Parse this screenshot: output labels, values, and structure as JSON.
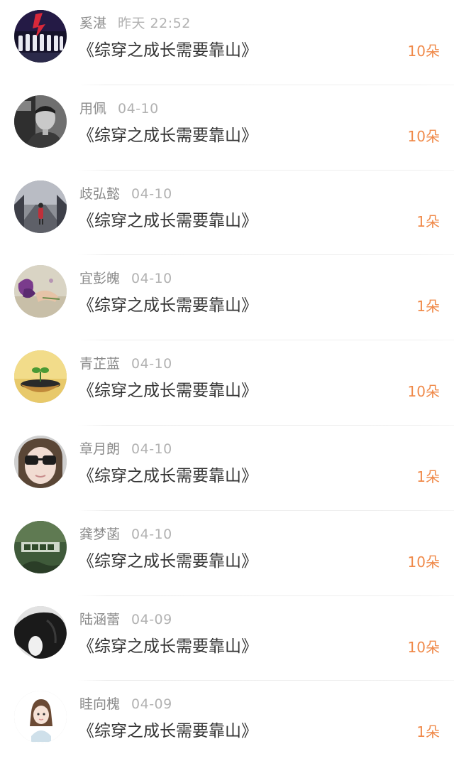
{
  "colors": {
    "amount": "#f08a4a",
    "name": "#8a8a8a",
    "time": "#b2b2b2",
    "title": "#333333"
  },
  "items": [
    {
      "name": "奚湛",
      "time": "昨天 22:52",
      "title": "《综穿之成长需要靠山》",
      "amount": "10朵",
      "avatar_icon": "stage-performers-avatar"
    },
    {
      "name": "用佩",
      "time": "04-10",
      "title": "《综穿之成长需要靠山》",
      "amount": "10朵",
      "avatar_icon": "man-portrait-avatar"
    },
    {
      "name": "歧弘懿",
      "time": "04-10",
      "title": "《综穿之成长需要靠山》",
      "amount": "1朵",
      "avatar_icon": "street-girl-avatar"
    },
    {
      "name": "宜彭魄",
      "time": "04-10",
      "title": "《综穿之成长需要靠山》",
      "amount": "1朵",
      "avatar_icon": "flowers-hand-avatar"
    },
    {
      "name": "青芷蓝",
      "time": "04-10",
      "title": "《综穿之成长需要靠山》",
      "amount": "10朵",
      "avatar_icon": "sprout-pot-avatar"
    },
    {
      "name": "章月朗",
      "time": "04-10",
      "title": "《综穿之成长需要靠山》",
      "amount": "1朵",
      "avatar_icon": "sunglasses-girl-avatar"
    },
    {
      "name": "龚梦菡",
      "time": "04-10",
      "title": "《综穿之成长需要靠山》",
      "amount": "10朵",
      "avatar_icon": "green-text-avatar"
    },
    {
      "name": "陆涵蕾",
      "time": "04-09",
      "title": "《综穿之成长需要靠山》",
      "amount": "10朵",
      "avatar_icon": "dark-hair-avatar"
    },
    {
      "name": "眭向槐",
      "time": "04-09",
      "title": "《综穿之成长需要靠山》",
      "amount": "1朵",
      "avatar_icon": "cartoon-girl-avatar"
    }
  ]
}
